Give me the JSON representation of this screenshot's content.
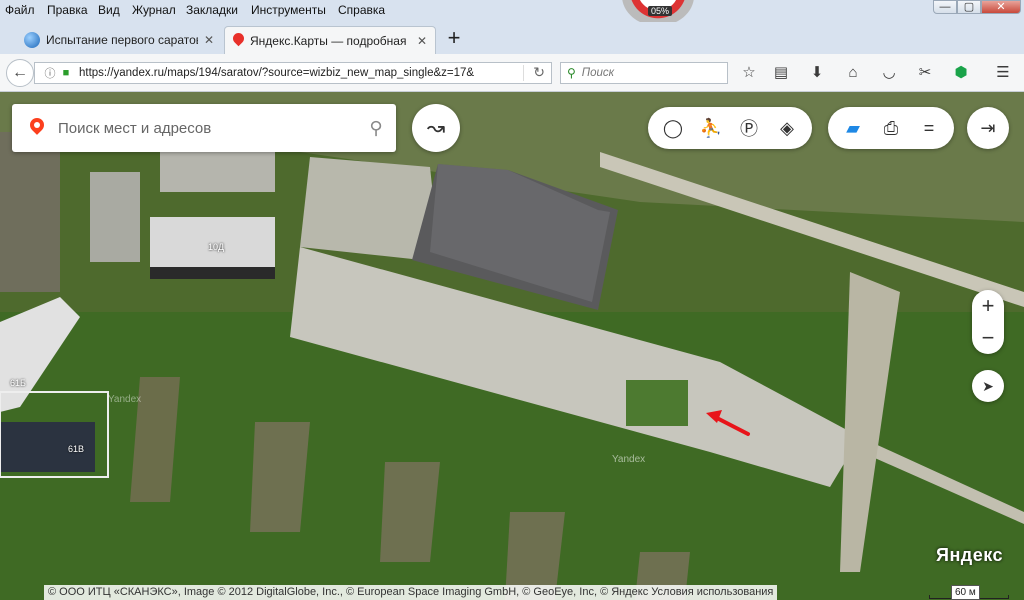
{
  "menubar": {
    "items": [
      "Файл",
      "Правка",
      "Вид",
      "Журнал",
      "Закладки",
      "Инструменты",
      "Справка"
    ]
  },
  "speedometer": {
    "value": "05%"
  },
  "window_controls": {
    "min": "—",
    "max": "▢",
    "close": "✕"
  },
  "tabs": [
    {
      "title": "Испытание первого саратов",
      "active": false
    },
    {
      "title": "Яндекс.Карты — подробная",
      "active": true
    }
  ],
  "new_tab_label": "+",
  "navbar": {
    "url": "https://yandex.ru/maps/194/saratov/?source=wizbiz_new_map_single&z=17&",
    "search_placeholder": "Поиск"
  },
  "map": {
    "search_placeholder": "Поиск мест и адресов",
    "building_labels": [
      "10Д",
      "61Б",
      "61В"
    ],
    "zoom_in": "+",
    "zoom_out": "−",
    "logo_text": "Яндекс",
    "watermarks": [
      "Yandex",
      "Yandex"
    ],
    "copyright": "© ООО ИТЦ «СКАНЭКС», Image © 2012 DigitalGlobe, Inc., © European Space Imaging GmbH, © GeoEye, Inc, © Яндекс",
    "terms_link": "Условия использования",
    "scale_label": "60 м"
  },
  "colors": {
    "yandex_red": "#fc3f1d",
    "annotation_arrow": "#e8141a",
    "tab_active_bg": "#f5f6f7"
  }
}
